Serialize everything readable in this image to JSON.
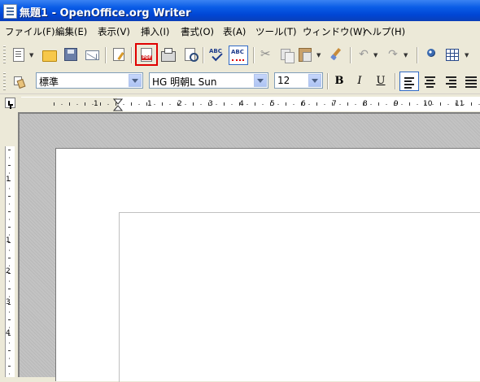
{
  "window": {
    "title": "無題1 - OpenOffice.org Writer"
  },
  "menu": [
    "ファイル(F)",
    "編集(E)",
    "表示(V)",
    "挿入(I)",
    "書式(O)",
    "表(A)",
    "ツール(T)",
    "ウィンドウ(W)",
    "ヘルプ(H)"
  ],
  "formatting": {
    "paragraph_style": "標準",
    "font_name": "HG 明朝L Sun",
    "font_size": "12",
    "bold": "B",
    "italic": "I",
    "underline": "U"
  },
  "ruler": {
    "labels": [
      "1",
      "1",
      "2",
      "3",
      "4",
      "5",
      "6",
      "7",
      "8",
      "9",
      "10",
      "11"
    ],
    "vertical_labels": [
      "1",
      "1",
      "2",
      "3",
      "4"
    ]
  },
  "icons": {
    "standard_toolbar": [
      "new-document",
      "open-folder",
      "save-disk",
      "email",
      "edit-file",
      "export-pdf",
      "print",
      "page-preview",
      "spellcheck",
      "autospellcheck",
      "cut",
      "copy",
      "paste",
      "clone-formatting",
      "undo",
      "redo",
      "navigator",
      "table"
    ],
    "highlighted": "export-pdf",
    "highlight_color": "#e00000"
  }
}
